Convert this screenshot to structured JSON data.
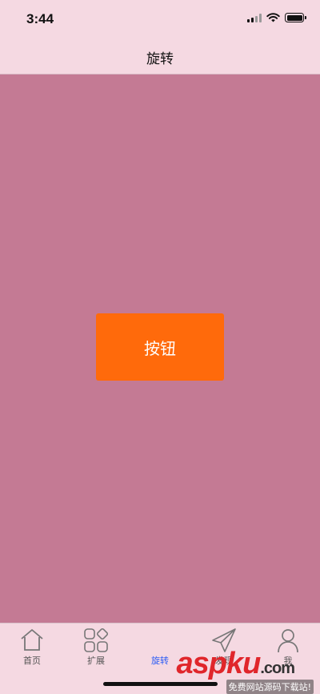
{
  "status_bar": {
    "time": "3:44",
    "icons": [
      "cellular-signal-icon",
      "wifi-icon",
      "battery-icon"
    ]
  },
  "nav": {
    "title": "旋转"
  },
  "content": {
    "background": "#c47a94",
    "button_label": "按钮",
    "button_color": "#ff6a0b"
  },
  "tab_bar": {
    "active_color": "#2a5bf5",
    "tabs": [
      {
        "label": "首页",
        "icon": "home-icon",
        "active": false
      },
      {
        "label": "扩展",
        "icon": "grid-icon",
        "active": false
      },
      {
        "label": "旋转",
        "icon": "none",
        "active": true
      },
      {
        "label": "发现",
        "icon": "paper-plane-icon",
        "active": false
      },
      {
        "label": "我",
        "icon": "person-icon",
        "active": false
      }
    ]
  },
  "watermark": {
    "logo": "aspku",
    "suffix": ".com",
    "tagline": "免费网站源码下载站!"
  }
}
